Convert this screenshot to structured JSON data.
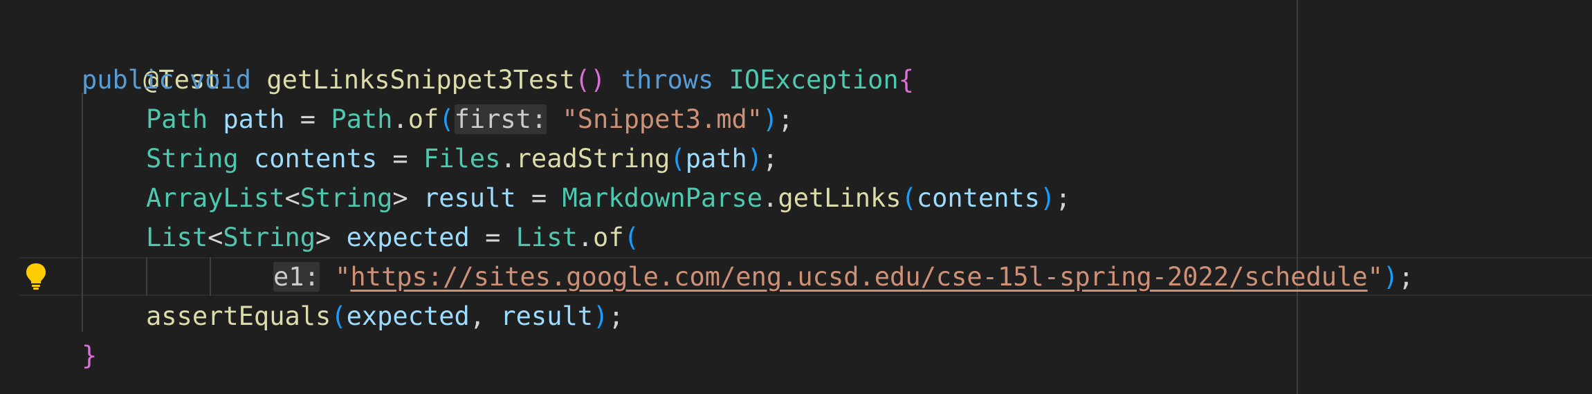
{
  "code": {
    "l1": {
      "annotation": "@Test"
    },
    "l2": {
      "kw_public": "public",
      "kw_void": "void",
      "method": "getLinksSnippet3Test",
      "parens": "()",
      "kw_throws": "throws",
      "exception": "IOException",
      "brace": "{"
    },
    "l3": {
      "type": "Path",
      "var": "path",
      "eq": " = ",
      "cls": "Path",
      "dot": ".",
      "fn": "of",
      "open": "(",
      "hint": "first:",
      "str": "\"Snippet3.md\"",
      "close": ")",
      "semi": ";"
    },
    "l4": {
      "type": "String",
      "var": "contents",
      "eq": " = ",
      "cls": "Files",
      "dot": ".",
      "fn": "readString",
      "open": "(",
      "arg": "path",
      "close": ")",
      "semi": ";"
    },
    "l5": {
      "type": "ArrayList",
      "lt": "<",
      "generic": "String",
      "gt": ">",
      "var": "result",
      "eq": " = ",
      "cls": "MarkdownParse",
      "dot": ".",
      "fn": "getLinks",
      "open": "(",
      "arg": "contents",
      "close": ")",
      "semi": ";"
    },
    "l6": {
      "type": "List",
      "lt": "<",
      "generic": "String",
      "gt": ">",
      "var": "expected",
      "eq": " = ",
      "cls": "List",
      "dot": ".",
      "fn": "of",
      "open": "("
    },
    "l7": {
      "hint": "e1:",
      "q1": "\"",
      "url": "https://sites.google.com/eng.ucsd.edu/cse-15l-spring-2022/schedule",
      "q2": "\"",
      "close": ")",
      "semi": ";"
    },
    "l8": {
      "fn": "assertEquals",
      "open": "(",
      "arg1": "expected",
      "comma": ", ",
      "arg2": "result",
      "close": ")",
      "semi": ";"
    },
    "l9": {
      "brace": "}"
    }
  },
  "icons": {
    "gutter": "lightbulb-icon"
  },
  "colors": {
    "background": "#1f1f1f",
    "keyword": "#569cd6",
    "type": "#4ec9b0",
    "function": "#dcdcaa",
    "variable": "#9cdcfe",
    "string": "#ce9178",
    "bracket_yellow": "#ffd700",
    "bracket_purple": "#da70d6",
    "bracket_blue": "#179fff",
    "lightbulb": "#ffcc00"
  }
}
